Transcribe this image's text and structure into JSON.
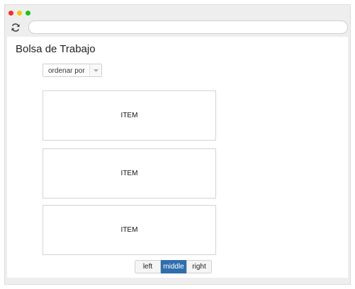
{
  "browser": {
    "address_value": "",
    "controls": [
      "close",
      "minimize",
      "maximize"
    ],
    "reload_icon": "reload-icon"
  },
  "page": {
    "title": "Bolsa de Trabajo"
  },
  "sort": {
    "label": "ordenar por",
    "icon": "chevron-down-icon"
  },
  "items": [
    {
      "label": "ITEM"
    },
    {
      "label": "ITEM"
    },
    {
      "label": "ITEM"
    }
  ],
  "pager": {
    "left": "left",
    "middle": "middle",
    "right": "right",
    "active": "middle",
    "active_color": "#2f6eae"
  }
}
